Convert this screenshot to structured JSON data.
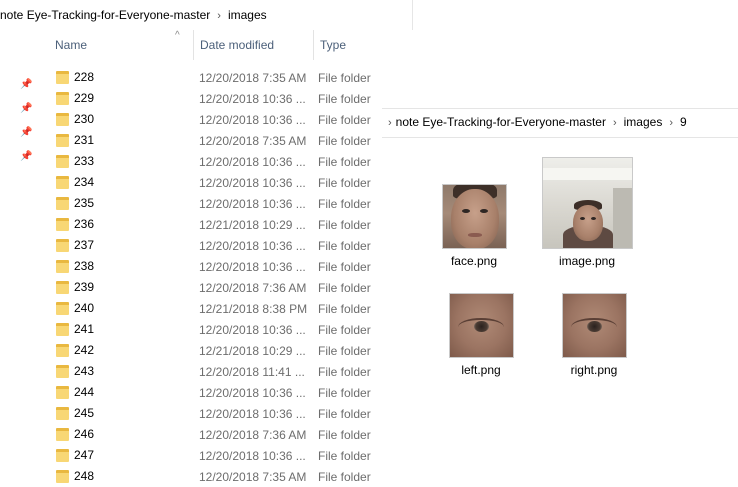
{
  "left_window": {
    "breadcrumb": [
      "note Eye-Tracking-for-Everyone-master",
      "images"
    ],
    "columns": {
      "name": "Name",
      "date": "Date modified",
      "type": "Type"
    },
    "rows": [
      {
        "name": "228",
        "date": "12/20/2018 7:35 AM",
        "type": "File folder"
      },
      {
        "name": "229",
        "date": "12/20/2018 10:36 ...",
        "type": "File folder"
      },
      {
        "name": "230",
        "date": "12/20/2018 10:36 ...",
        "type": "File folder"
      },
      {
        "name": "231",
        "date": "12/20/2018 7:35 AM",
        "type": "File folder"
      },
      {
        "name": "233",
        "date": "12/20/2018 10:36 ...",
        "type": "File folder"
      },
      {
        "name": "234",
        "date": "12/20/2018 10:36 ...",
        "type": "File folder"
      },
      {
        "name": "235",
        "date": "12/20/2018 10:36 ...",
        "type": "File folder"
      },
      {
        "name": "236",
        "date": "12/21/2018 10:29 ...",
        "type": "File folder"
      },
      {
        "name": "237",
        "date": "12/20/2018 10:36 ...",
        "type": "File folder"
      },
      {
        "name": "238",
        "date": "12/20/2018 10:36 ...",
        "type": "File folder"
      },
      {
        "name": "239",
        "date": "12/20/2018 7:36 AM",
        "type": "File folder"
      },
      {
        "name": "240",
        "date": "12/21/2018 8:38 PM",
        "type": "File folder"
      },
      {
        "name": "241",
        "date": "12/20/2018 10:36 ...",
        "type": "File folder"
      },
      {
        "name": "242",
        "date": "12/21/2018 10:29 ...",
        "type": "File folder"
      },
      {
        "name": "243",
        "date": "12/20/2018 11:41 ...",
        "type": "File folder"
      },
      {
        "name": "244",
        "date": "12/20/2018 10:36 ...",
        "type": "File folder"
      },
      {
        "name": "245",
        "date": "12/20/2018 10:36 ...",
        "type": "File folder"
      },
      {
        "name": "246",
        "date": "12/20/2018 7:36 AM",
        "type": "File folder"
      },
      {
        "name": "247",
        "date": "12/20/2018 10:36 ...",
        "type": "File folder"
      },
      {
        "name": "248",
        "date": "12/20/2018 7:35 AM",
        "type": "File folder"
      }
    ]
  },
  "right_window": {
    "breadcrumb": [
      "note Eye-Tracking-for-Everyone-master",
      "images",
      "9"
    ],
    "files": [
      {
        "name": "face.png",
        "icon": "face-thumbnail"
      },
      {
        "name": "image.png",
        "icon": "room-face-thumbnail"
      },
      {
        "name": "left.png",
        "icon": "left-eye-thumbnail"
      },
      {
        "name": "right.png",
        "icon": "right-eye-thumbnail"
      }
    ]
  },
  "colors": {
    "folder": "#f8d775",
    "header_text": "#4c607a",
    "meta_text": "#6d6d6d"
  }
}
